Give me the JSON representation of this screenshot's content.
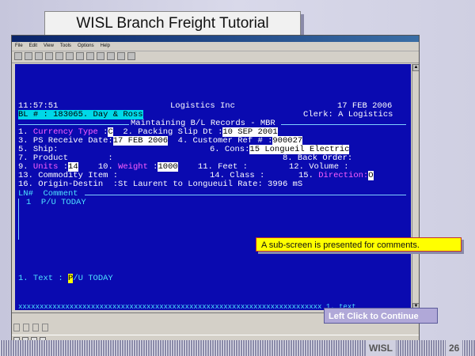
{
  "slide_title": "WISL Branch Freight Tutorial",
  "window": {
    "menu": [
      "File",
      "Edit",
      "View",
      "Tools",
      "Options",
      "Help"
    ]
  },
  "terminal": {
    "time": "11:57:51",
    "company": "Logistics Inc",
    "date": "17 FEB 2006",
    "bl_label": "BL # : 183065. Day & Ross",
    "clerk": "Clerk: A Logistics",
    "screen_title": "Maintaining B/L Records - MBR",
    "f1_label": "1. ",
    "f1_name": "Currency Type",
    "f1_colon": " :",
    "f1_value": "C",
    "f2_label": "  2. Packing Slip Dt :",
    "f2_value": "10 SEP 2001",
    "f3_label": "3. PS Receive Date:",
    "f3_value": "17 FEB 2006",
    "f4_label": "  4. Customer Ref # :",
    "f4_value": "900027",
    "f5_label": "5. Ship:",
    "f6_label": "6. Cons:",
    "f6_value": "15 Longueil Electric",
    "f7_label": "7. Product        :",
    "f8_label": "8. Back Order:",
    "f9_label": "9. ",
    "f9_name": "Units",
    "f9_colon": " :",
    "f9_value": "14",
    "f10_label": "    10. ",
    "f10_name": "Weight",
    "f10_colon": " :",
    "f10_value": "1000",
    "f11_label": "    11. Feet :",
    "f12_label": "12. Volume :",
    "f13_label": "13. Commodity Item :",
    "f14_label": "14. Class :",
    "f15_label": "15. ",
    "f15_name": "Direction:",
    "f15_value": "O",
    "f16_label": "16. Origin-Destin  :St Laurent to Longueuil Rate: 3996 mS",
    "comment_header": "LN#  Comment",
    "comment_rows": [
      {
        "ln": "1",
        "text": "P/U TODAY"
      }
    ],
    "text_label": "1. Text : ",
    "text_cursor": "P",
    "text_value": "/U TODAY",
    "bottom_line": "xxxxxxxxxxxxxxxxxxxxxxxxxxxxxxxxxxxxxxxxxxxxxxxxxxxxxxxxxxxxxxxxxxxxxxx 1. text"
  },
  "callout": "A sub-screen is presented for comments.",
  "continue_button": "Left Click to Continue",
  "footer": {
    "brand": "WISL",
    "page": "26"
  }
}
